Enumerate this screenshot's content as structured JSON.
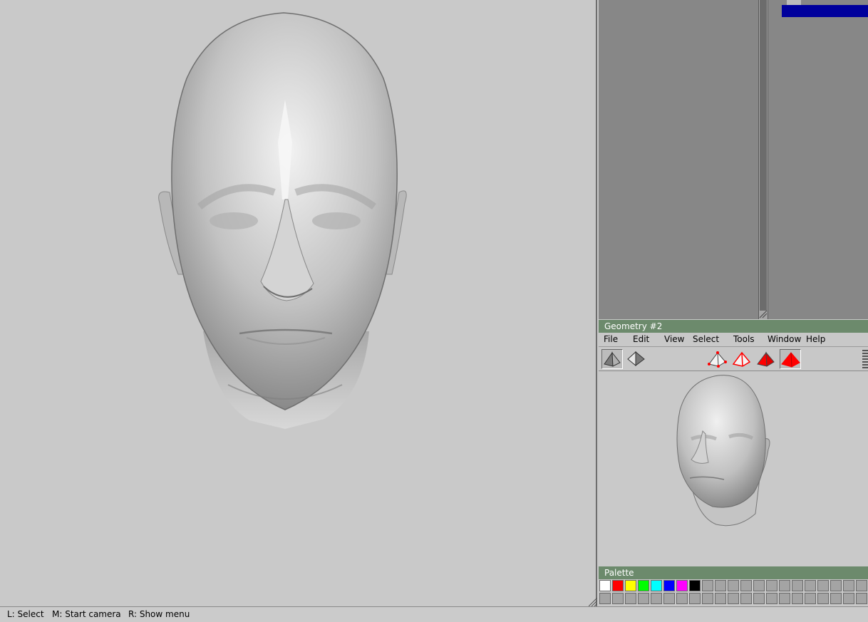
{
  "geometry_window": {
    "title": "Geometry #2",
    "menu": [
      "File",
      "Edit",
      "View",
      "Select",
      "Tools",
      "Window",
      "Help"
    ]
  },
  "palette": {
    "title": "Palette",
    "colors": [
      "#ffffff",
      "#ff0000",
      "#ffff00",
      "#00ff00",
      "#00ffff",
      "#0000ff",
      "#ff00ff",
      "#000000"
    ],
    "empty_color": "#a4a4a4"
  },
  "status_bar": {
    "left": "L: Select",
    "middle": "M: Start camera",
    "right": "R: Show menu"
  },
  "colors": {
    "title_bar": "#6c8a6c",
    "selection": "#00009c",
    "active_red": "#ff0000"
  }
}
